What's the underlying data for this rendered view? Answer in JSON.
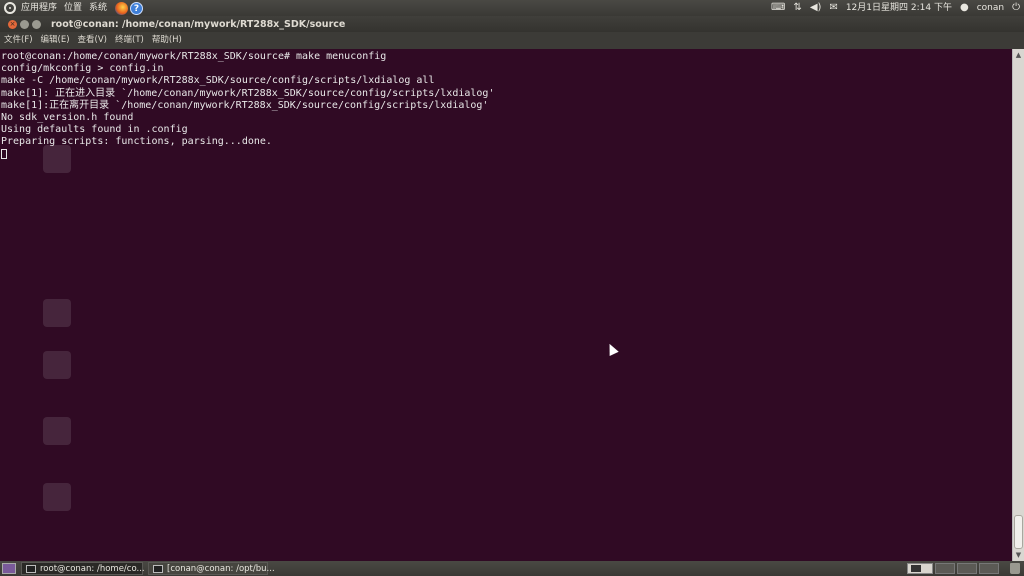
{
  "top_panel": {
    "menus": [
      "应用程序",
      "位置",
      "系统"
    ],
    "datetime": "12月1日星期四  2:14 下午",
    "user": "conan"
  },
  "window": {
    "title": "root@conan: /home/conan/mywork/RT288x_SDK/source",
    "menu": [
      "文件(F)",
      "编辑(E)",
      "查看(V)",
      "终端(T)",
      "帮助(H)"
    ]
  },
  "terminal": {
    "lines": [
      "root@conan:/home/conan/mywork/RT288x_SDK/source# make menuconfig",
      "config/mkconfig > config.in",
      "make -C /home/conan/mywork/RT288x_SDK/source/config/scripts/lxdialog all",
      "make[1]: 正在进入目录 `/home/conan/mywork/RT288x_SDK/source/config/scripts/lxdialog'",
      "make[1]:正在离开目录 `/home/conan/mywork/RT288x_SDK/source/config/scripts/lxdialog'",
      "No sdk_version.h found",
      "Using defaults found in .config",
      "Preparing scripts: functions, parsing...done."
    ]
  },
  "taskbar": {
    "tasks": [
      "root@conan: /home/co...",
      "[conan@conan: /opt/bu..."
    ]
  },
  "icons": {
    "top_left": "ubuntu-logo",
    "launchers": [
      "firefox",
      "help"
    ],
    "tray": [
      "keyboard",
      "network",
      "volume",
      "mail",
      "power"
    ]
  }
}
